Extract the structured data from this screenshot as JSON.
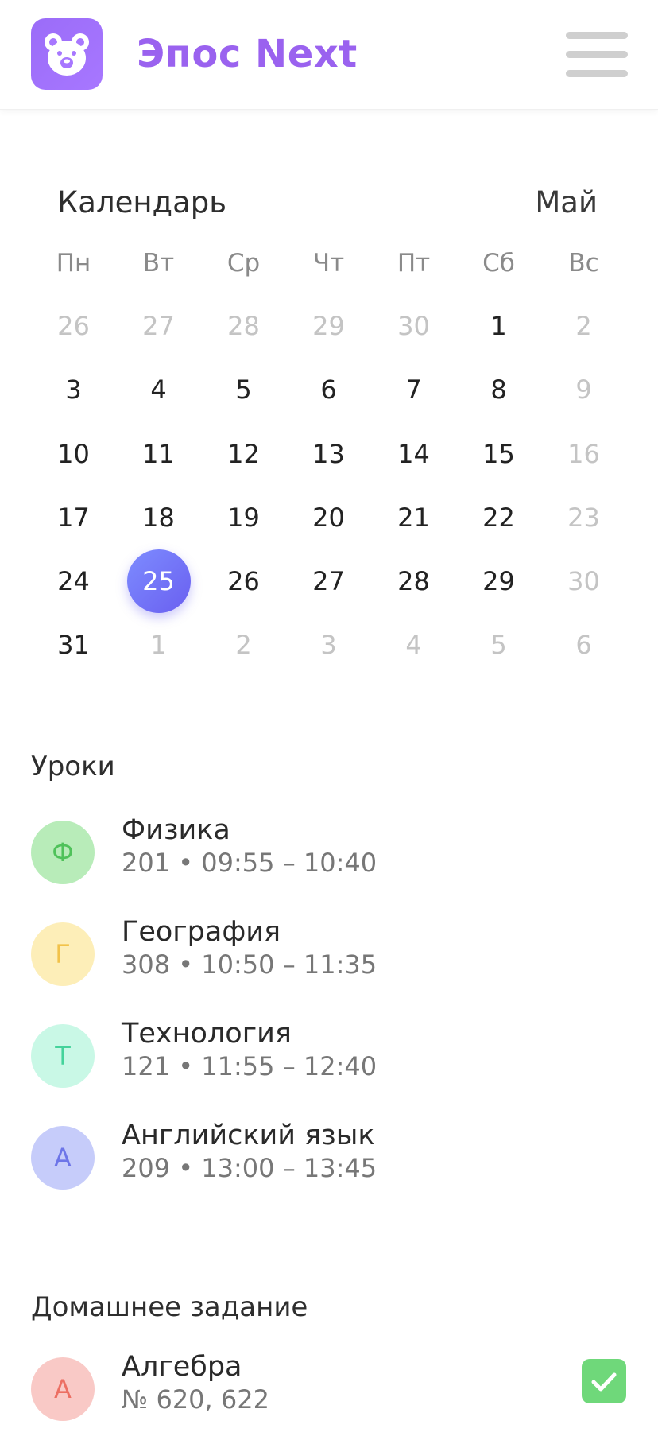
{
  "header": {
    "app_title": "Эпос Next",
    "logo_icon": "bear-icon",
    "menu_icon": "hamburger-menu-icon",
    "brand_color": "#9a62ef"
  },
  "calendar": {
    "title": "Календарь",
    "month": "Май",
    "weekdays": [
      "Пн",
      "Вт",
      "Ср",
      "Чт",
      "Пт",
      "Сб",
      "Вс"
    ],
    "selected_day": "25",
    "days": [
      {
        "d": "26",
        "muted": true
      },
      {
        "d": "27",
        "muted": true
      },
      {
        "d": "28",
        "muted": true
      },
      {
        "d": "29",
        "muted": true
      },
      {
        "d": "30",
        "muted": true
      },
      {
        "d": "1",
        "muted": false
      },
      {
        "d": "2",
        "muted": true
      },
      {
        "d": "3",
        "muted": false
      },
      {
        "d": "4",
        "muted": false
      },
      {
        "d": "5",
        "muted": false
      },
      {
        "d": "6",
        "muted": false
      },
      {
        "d": "7",
        "muted": false
      },
      {
        "d": "8",
        "muted": false
      },
      {
        "d": "9",
        "muted": true
      },
      {
        "d": "10",
        "muted": false
      },
      {
        "d": "11",
        "muted": false
      },
      {
        "d": "12",
        "muted": false
      },
      {
        "d": "13",
        "muted": false
      },
      {
        "d": "14",
        "muted": false
      },
      {
        "d": "15",
        "muted": false
      },
      {
        "d": "16",
        "muted": true
      },
      {
        "d": "17",
        "muted": false
      },
      {
        "d": "18",
        "muted": false
      },
      {
        "d": "19",
        "muted": false
      },
      {
        "d": "20",
        "muted": false
      },
      {
        "d": "21",
        "muted": false
      },
      {
        "d": "22",
        "muted": false
      },
      {
        "d": "23",
        "muted": true
      },
      {
        "d": "24",
        "muted": false
      },
      {
        "d": "25",
        "muted": false,
        "selected": true
      },
      {
        "d": "26",
        "muted": false
      },
      {
        "d": "27",
        "muted": false
      },
      {
        "d": "28",
        "muted": false
      },
      {
        "d": "29",
        "muted": false
      },
      {
        "d": "30",
        "muted": true
      },
      {
        "d": "31",
        "muted": false
      },
      {
        "d": "1",
        "muted": true
      },
      {
        "d": "2",
        "muted": true
      },
      {
        "d": "3",
        "muted": true
      },
      {
        "d": "4",
        "muted": true
      },
      {
        "d": "5",
        "muted": true
      },
      {
        "d": "6",
        "muted": true
      }
    ]
  },
  "lessons": {
    "title": "Уроки",
    "items": [
      {
        "letter": "Ф",
        "name": "Физика",
        "room": "201",
        "time": "09:55 – 10:40",
        "bg": "#b8ecb9",
        "fg": "#4fc25a"
      },
      {
        "letter": "Г",
        "name": "География",
        "room": "308",
        "time": "10:50 – 11:35",
        "bg": "#fdeeb8",
        "fg": "#f2c24a"
      },
      {
        "letter": "Т",
        "name": "Технология",
        "room": "121",
        "time": "11:55 – 12:40",
        "bg": "#c9f8e6",
        "fg": "#44d39b"
      },
      {
        "letter": "А",
        "name": "Английский язык",
        "room": "209",
        "time": "13:00 – 13:45",
        "bg": "#c6ccfa",
        "fg": "#6d75e8"
      }
    ]
  },
  "homework": {
    "title": "Домашнее задание",
    "items": [
      {
        "letter": "А",
        "name": "Алгебра",
        "detail": "№ 620, 622",
        "bg": "#f9c9c6",
        "fg": "#ec6f63",
        "done": true,
        "check_icon": "checkmark-icon",
        "check_color": "#6fd87a"
      }
    ]
  }
}
